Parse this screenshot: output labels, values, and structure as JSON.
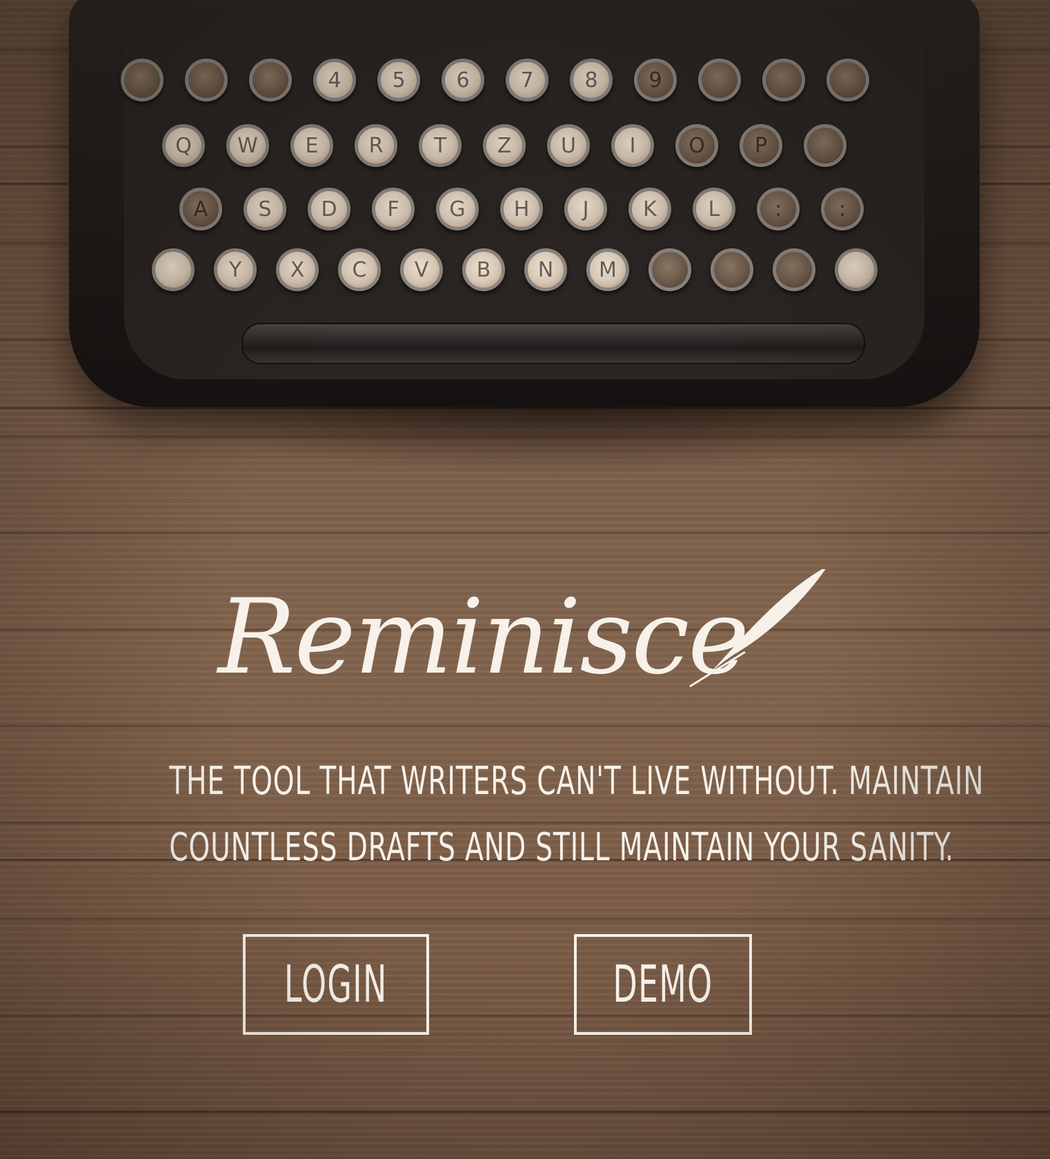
{
  "brand": {
    "logo_text": "Reminisce",
    "logo_icon": "quill-feather-icon"
  },
  "hero": {
    "tagline_line1": "The tool that writers can't live without. Maintain",
    "tagline_line2": "countless drafts and still maintain your sanity."
  },
  "actions": {
    "login_label": "LOGIN",
    "demo_label": "DEMO"
  },
  "background": {
    "image": "vintage-typewriter-on-wooden-desk",
    "keys_row1": [
      "",
      "",
      "",
      "4",
      "5",
      "6",
      "7",
      "8",
      "9",
      "",
      "",
      ""
    ],
    "keys_row2": [
      "Q",
      "W",
      "E",
      "R",
      "T",
      "Z",
      "U",
      "I",
      "O",
      "P",
      ""
    ],
    "keys_row3": [
      "A",
      "S",
      "D",
      "F",
      "G",
      "H",
      "J",
      "K",
      "L",
      ":",
      ":"
    ],
    "keys_row4": [
      "",
      "Y",
      "X",
      "C",
      "V",
      "B",
      "N",
      "M",
      "",
      "",
      "",
      ""
    ]
  },
  "colors": {
    "text": "#f7f1ea",
    "wood": "#7a5d48",
    "typewriter": "#1e1a19"
  }
}
